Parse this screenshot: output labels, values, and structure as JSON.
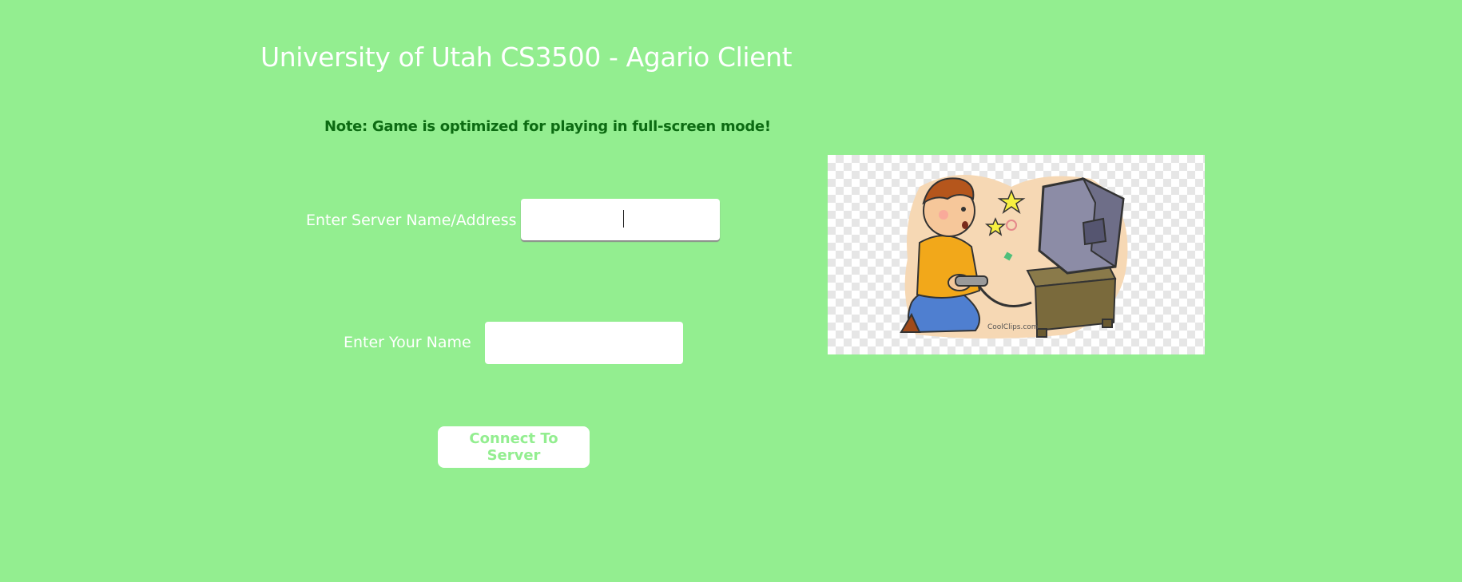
{
  "window": {
    "title": "University of Utah CS3500 - Agario Client",
    "note": "Note: Game is optimized for playing in full-screen mode!"
  },
  "form": {
    "server_label": "Enter Server Name/Address",
    "server_value": "",
    "name_label": "Enter Your Name",
    "name_value": "",
    "connect_label": "Connect To Server"
  },
  "illustration": {
    "subject": "boy-playing-video-game-clipart",
    "watermark": "CoolClips.com"
  },
  "colors": {
    "background": "#93ee90",
    "note_text": "#0c6b12",
    "button_text": "#93ee90"
  }
}
